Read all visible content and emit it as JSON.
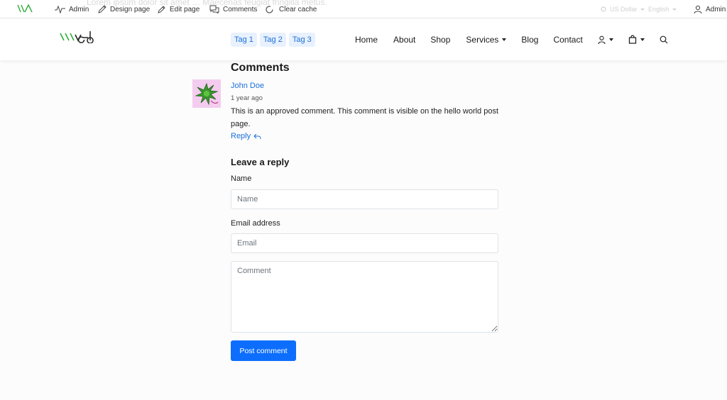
{
  "adminbar": {
    "ghost_text": "Lorem ipsum dolor sit amet … Maecenas feugiat fringilla metus.",
    "items": [
      {
        "label": "Admin",
        "icon": "activity-icon"
      },
      {
        "label": "Design page",
        "icon": "pencil-icon"
      },
      {
        "label": "Edit page",
        "icon": "edit-icon"
      },
      {
        "label": "Comments",
        "icon": "comments-icon"
      },
      {
        "label": "Clear cache",
        "icon": "refresh-icon"
      }
    ],
    "currency": "US Dollar",
    "language": "English",
    "user_label": "Admin"
  },
  "header": {
    "tags": [
      "Tag 1",
      "Tag 2",
      "Tag 3"
    ],
    "nav": [
      "Home",
      "About",
      "Shop",
      "Services",
      "Blog",
      "Contact"
    ]
  },
  "comments": {
    "heading": "Comments",
    "items": [
      {
        "author": "John Doe",
        "time": "1 year ago",
        "text": "This is an approved comment. This comment is visible on the hello world post page.",
        "reply_label": "Reply"
      }
    ]
  },
  "reply_form": {
    "heading": "Leave a reply",
    "name_label": "Name",
    "name_placeholder": "Name",
    "email_label": "Email address",
    "email_placeholder": "Email",
    "comment_placeholder": "Comment",
    "submit_label": "Post comment"
  },
  "colors": {
    "accent": "#0d6efd",
    "link": "#1b6fdb",
    "logo_green": "#2fae3b"
  }
}
